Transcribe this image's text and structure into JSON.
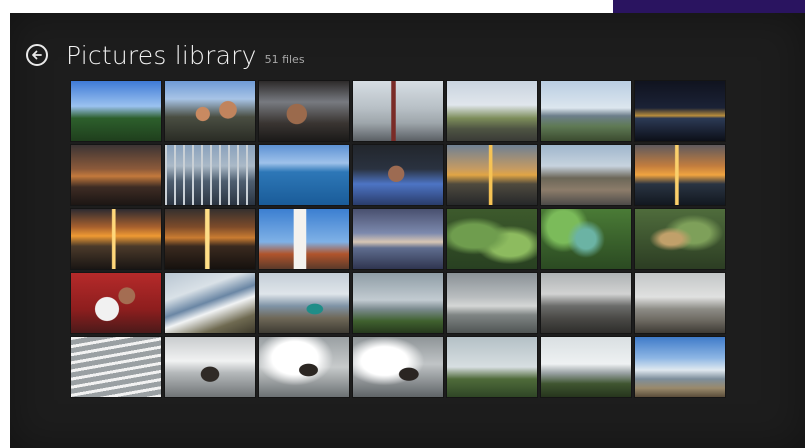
{
  "header": {
    "title": "Pictures library",
    "file_count": "51 files",
    "back_icon": "back-arrow-icon"
  },
  "colors": {
    "background": "#1d1d1d",
    "title": "#f2f2f2",
    "subtitle": "#a8a8a8",
    "corner_accent": "#2a1460"
  },
  "thumbnails": [
    {
      "name": "photo-forest-blue-sky",
      "style": "linear-gradient(180deg,#3e7ad6 0%,#9bc2f0 42%,#2d5f2c 62%,#1f3f1d 100%)"
    },
    {
      "name": "photo-couple-selfie",
      "style": "radial-gradient(circle at 42% 55%,#c98a61 0 11%,transparent 12%),radial-gradient(circle at 70% 48%,#c1845d 0 12%,transparent 13%),linear-gradient(180deg,#6f9bd6 0%,#a8c4e6 30%,#4a4e42 60%,#2a2c25 100%)"
    },
    {
      "name": "photo-man-in-car",
      "style": "radial-gradient(circle at 42% 55%,#9b6a4c 0 16%,transparent 17%),linear-gradient(180deg,#2d2a2a 0%,#777a80 35%,#3a3532 70%,#1b1a19 100%)"
    },
    {
      "name": "photo-man-at-fountain",
      "style": "linear-gradient(90deg,transparent 0 42%,#7a2b27 43% 47%,transparent 48%),linear-gradient(180deg,#d6dde3 0%,#b8c0c6 45%,#9ea6ab 70%,#5a5f64 100%)"
    },
    {
      "name": "photo-highway-sky",
      "style": "linear-gradient(180deg,#c8d3df 0%,#e0e6ec 40%,#7d8d5a 62%,#4e5443 80%,#3a3b36 100%)"
    },
    {
      "name": "photo-city-skyline-bay",
      "style": "linear-gradient(180deg,#b9cde2 0%,#dce6ee 45%,#6d7f8b 58%,#5f7a55 75%,#3b4b2f 100%)"
    },
    {
      "name": "photo-city-lights-night",
      "style": "linear-gradient(180deg,#10131f 0%,#1b2236 45%,#b88d3c 58%,#2c3a55 62%,#0c0f18 100%)"
    },
    {
      "name": "photo-dusk-shoreline",
      "style": "linear-gradient(180deg,#3c3434 0%,#8c5a3a 40%,#c3793c 52%,#3e2c24 70%,#1c1614 100%)"
    },
    {
      "name": "photo-marina-boats",
      "style": "repeating-linear-gradient(90deg,#c9d0d6 0 2px,transparent 2px 9px),linear-gradient(180deg,#8aa2bd 0%,#aab9c7 35%,#4f5f70 60%,#2b3542 100%)"
    },
    {
      "name": "photo-blue-ocean",
      "style": "linear-gradient(180deg,#5d92d4 0%,#9fc2ea 30%,#2d77b7 45%,#1a5c99 100%)"
    },
    {
      "name": "photo-man-sunglasses",
      "style": "radial-gradient(circle at 48% 48%,#9d6b52 0 14%,transparent 15%),linear-gradient(180deg,#22262c 0%,#2a3240 40%,#4d74c4 65%,#2a3c6b 100%)"
    },
    {
      "name": "photo-sunset-over-water",
      "style": "linear-gradient(90deg,transparent 0 46%,#f6c354 47% 50%,transparent 51%),linear-gradient(180deg,#6f8093 0%,#c69b62 40%,#e1a545 50%,#4f4a3e 65%,#26282a 100%)"
    },
    {
      "name": "photo-city-hillside",
      "style": "linear-gradient(180deg,#9fb6cc 0%,#c7d3de 35%,#6c6758 55%,#8c7c6a 75%,#4d4b49 100%)"
    },
    {
      "name": "photo-orange-sunset-sea",
      "style": "linear-gradient(90deg,transparent 0 44%,#fbd06b 45% 48%,transparent 49%),linear-gradient(180deg,#5f5a5e 0%,#c27d3e 35%,#f0a440 50%,#2a3442 65%,#121820 100%)"
    },
    {
      "name": "photo-golden-sunset",
      "style": "linear-gradient(90deg,transparent 0 45%,#ffd77a 46% 49%,transparent 50%),linear-gradient(180deg,#2d2b30 0%,#a8612e 30%,#ef9a33 45%,#4b3a2a 62%,#1a1614 100%)"
    },
    {
      "name": "photo-sun-reflection",
      "style": "linear-gradient(90deg,transparent 0 44%,#ffde86 45% 49%,transparent 50%),linear-gradient(180deg,#35302e 0%,#7d4b2a 30%,#ca7c31 48%,#3a2a1f 62%,#16110e 100%)"
    },
    {
      "name": "photo-lighthouse",
      "style": "linear-gradient(90deg,transparent 0 38%,#f4f2ee 39% 52%,transparent 53%),linear-gradient(180deg,#3c7fd1 0%,#7fb1e6 55%,#b0542c 75%,#5b3a2a 100%)"
    },
    {
      "name": "photo-city-skyline-dusk",
      "style": "linear-gradient(180deg,#49506f 0%,#7c89ad 40%,#d7c6b4 55%,#5f6d8e 65%,#2f3550 100%)"
    },
    {
      "name": "photo-fern-leaves",
      "style": "radial-gradient(ellipse at 30% 45%,#6f9d4e 0 25%,transparent 40%),radial-gradient(ellipse at 70% 60%,#8dbb5f 0 22%,transparent 38%),linear-gradient(180deg,#3d5a2c 0%,#284021 100%)"
    },
    {
      "name": "photo-succulent-plant",
      "style": "radial-gradient(circle at 50% 50%,#6bb3a4 0 18%,transparent 35%),radial-gradient(circle at 25% 30%,#7bbb5a 0 20%,transparent 32%),linear-gradient(180deg,#4a7b36 0%,#2b4a22 100%)"
    },
    {
      "name": "photo-tropical-foliage",
      "style": "radial-gradient(ellipse at 40% 50%,#c1a06a 0 14%,transparent 28%),radial-gradient(ellipse at 65% 40%,#7ea05a 0 20%,transparent 36%),linear-gradient(180deg,#4f6c3c 0%,#2c3d23 100%)"
    },
    {
      "name": "photo-woman-with-panda",
      "style": "radial-gradient(circle at 40% 60%,#f1f1f1 0 18%,transparent 19%),radial-gradient(circle at 62% 38%,#a46d52 0 12%,transparent 13%),linear-gradient(180deg,#b52a2a 0%,#8e1e1e 60%,#4b1a1a 100%)"
    },
    {
      "name": "photo-coastline-beach",
      "style": "linear-gradient(160deg,#b9c6d2 0%,#d9e1e7 30%,#6a86a4 48%,#f1f3f4 60%,#6f6a51 80%,#3e3a2c 100%)"
    },
    {
      "name": "photo-woman-at-coast",
      "style": "radial-gradient(ellipse at 62% 60%,#1f8d88 0 10%,transparent 11%),linear-gradient(180deg,#c4ced7 0%,#dfe5ea 35%,#7f93a6 55%,#6f6858 75%,#3e3b33 100%)"
    },
    {
      "name": "photo-green-cliffs",
      "style": "linear-gradient(180deg,#8f9da6 0%,#c2cbd1 45%,#7c8b8f 60%,#40612f 80%,#26391d 100%)"
    },
    {
      "name": "photo-surf-shore",
      "style": "linear-gradient(180deg,#8a9196 0%,#b9bdbf 40%,#d5d7d6 55%,#7f8584 70%,#505554 100%)"
    },
    {
      "name": "photo-rocky-beach",
      "style": "linear-gradient(180deg,#aeb2b4 0%,#d2d3d2 35%,#6b6c6a 55%,#4b4a47 75%,#2e2d2b 100%)"
    },
    {
      "name": "photo-pebble-shore",
      "style": "linear-gradient(180deg,#c3c6c7 0%,#e0e1e0 40%,#8d8c86 60%,#6b675f 80%,#3e3b35 100%)"
    },
    {
      "name": "photo-waves-surf",
      "style": "repeating-linear-gradient(170deg,#f2f2f2 0 3px,#9aa0a3 3px 8px),linear-gradient(180deg,#b5b9bb 0%,#7f8487 100%)"
    },
    {
      "name": "photo-rocks-spray",
      "style": "radial-gradient(ellipse at 50% 62%,#2f2a26 0 14%,transparent 15%),linear-gradient(180deg,#c9ccce 0%,#f1f2f2 40%,#b4b8ba 60%,#707476 100%)"
    },
    {
      "name": "photo-crashing-wave",
      "style": "radial-gradient(ellipse at 55% 55%,#2b2622 0 13%,transparent 14%),radial-gradient(ellipse at 40% 35%,#ffffff 0 30%,transparent 50%),linear-gradient(180deg,#9aa0a3 0%,#c7cacb 50%,#6b7073 100%)"
    },
    {
      "name": "photo-wave-splash-rocks",
      "style": "radial-gradient(ellipse at 62% 62%,#2a2522 0 12%,transparent 13%),radial-gradient(ellipse at 35% 40%,#ffffff 0 28%,transparent 48%),linear-gradient(180deg,#8f9598 0%,#c0c4c6 45%,#5f6467 100%)"
    },
    {
      "name": "photo-green-hills-fog",
      "style": "linear-gradient(180deg,#b4c0c6 0%,#d7dee1 50%,#4f6b3a 70%,#2f4626 100%)"
    },
    {
      "name": "photo-hill-overcast",
      "style": "linear-gradient(180deg,#d9dfe2 0%,#eef1f2 45%,#9aa2a4 60%,#3f5530 78%,#26351d 100%)"
    },
    {
      "name": "photo-coastline-sky",
      "style": "linear-gradient(180deg,#3f7bc9 0%,#8db6e4 35%,#dfe8ef 55%,#7d8e9b 70%,#9a8a6c 85%,#5a4d3a 100%)"
    }
  ]
}
